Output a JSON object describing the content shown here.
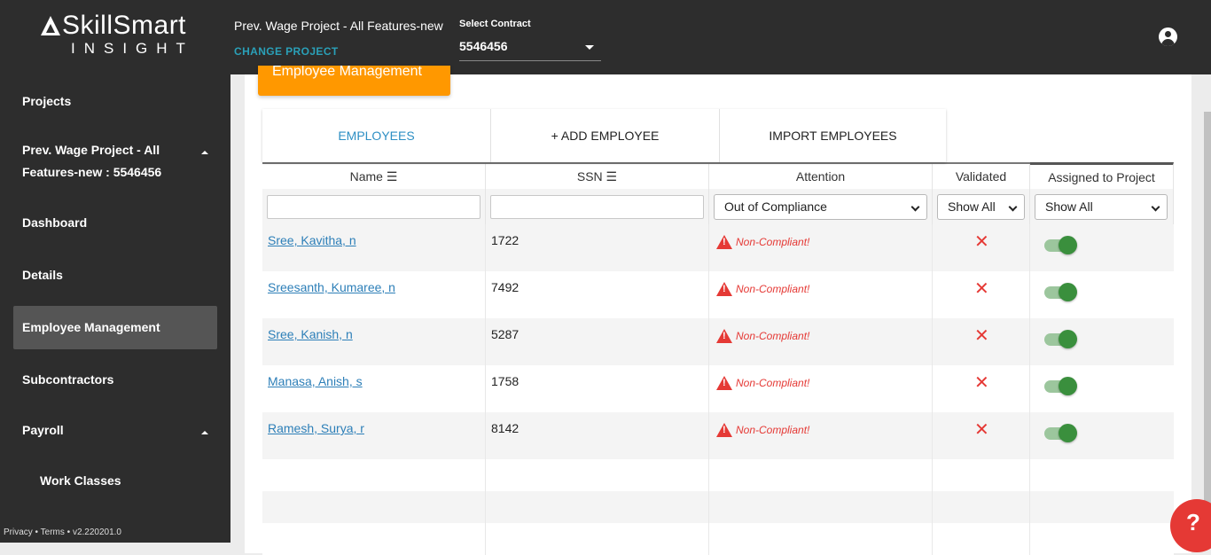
{
  "header": {
    "logo_main": "SkillSmart",
    "logo_sub": "INSIGHT",
    "project_name": "Prev. Wage Project - All Features-new",
    "change_project": "CHANGE PROJECT",
    "contract_label": "Select Contract",
    "contract_value": "5546456"
  },
  "sidebar": {
    "items": [
      {
        "label": "Projects"
      },
      {
        "label": "Prev. Wage Project - All"
      },
      {
        "label": "Features-new : 5546456"
      },
      {
        "label": "Dashboard"
      },
      {
        "label": "Details"
      },
      {
        "label": "Employee Management",
        "active": true
      },
      {
        "label": "Subcontractors"
      },
      {
        "label": "Payroll"
      },
      {
        "label": "Work Classes"
      }
    ],
    "footer": "Privacy • Terms • v2.220201.0"
  },
  "page": {
    "section_tab": "Employee Management"
  },
  "tabs": [
    {
      "label": "EMPLOYEES",
      "active": true
    },
    {
      "label": "+ ADD EMPLOYEE"
    },
    {
      "label": "IMPORT EMPLOYEES"
    }
  ],
  "table": {
    "columns": [
      "Name ☰",
      "SSN ☰",
      "Attention",
      "Validated",
      "Assigned to Project"
    ],
    "filters": {
      "attention": "Out of Compliance",
      "validated": "Show All",
      "assigned": "Show All"
    },
    "status_text": "Non-Compliant!",
    "rows": [
      {
        "name": "Sree, Kavitha, n",
        "ssn": "1722"
      },
      {
        "name": "Sreesanth, Kumaree, n",
        "ssn": "7492"
      },
      {
        "name": "Sree, Kanish, n",
        "ssn": "5287"
      },
      {
        "name": "Manasa, Anish, s",
        "ssn": "1758"
      },
      {
        "name": "Ramesh, Surya, r",
        "ssn": "8142"
      }
    ]
  },
  "help": {
    "label": "?"
  },
  "icons": {
    "account": "account-circle-icon",
    "warning": "warning-icon",
    "not_validated": "close-icon",
    "help": "help-icon"
  },
  "colors": {
    "topbar": "#2d2d2d",
    "accent_orange": "#ff9800",
    "link_blue": "#2d7fb8",
    "error_red": "#e53935",
    "toggle_green": "#3a8f3d"
  }
}
